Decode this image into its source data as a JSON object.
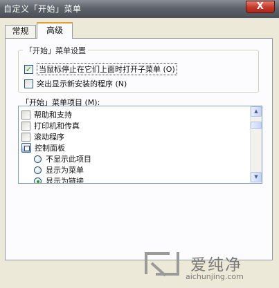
{
  "window": {
    "title": "自定义「开始」菜单",
    "close_glyph": "X"
  },
  "tabs": [
    {
      "label": "常规",
      "active": false
    },
    {
      "label": "高级",
      "active": true
    }
  ],
  "start_menu_settings": {
    "legend": "「开始」菜单设置",
    "options": [
      {
        "label": "当鼠标停止在它们上面时打开子菜单 (O)",
        "checked": true
      },
      {
        "label": "突出显示新安装的程序 (N)",
        "checked": false
      }
    ]
  },
  "items_list": {
    "label": "「开始」菜单项目 (M):",
    "items": [
      {
        "label": "帮助和支持",
        "type": "checkbox",
        "checked": false
      },
      {
        "label": "打印机和传真",
        "type": "checkbox",
        "checked": false
      },
      {
        "label": "滚动程序",
        "type": "checkbox",
        "checked": false
      },
      {
        "label": "控制面板",
        "type": "group",
        "icon": "control-panel-icon"
      },
      {
        "label": "不显示此项目",
        "type": "radio",
        "selected": false
      },
      {
        "label": "显示为菜单",
        "type": "radio",
        "selected": false
      },
      {
        "label": "显示为链接",
        "type": "radio",
        "selected": true
      }
    ]
  },
  "watermark": {
    "brand": "爱纯净",
    "url": "aichunjing.com"
  },
  "colors": {
    "accent_green": "#21a121",
    "tab_highlight": "#e6a02a",
    "titlebar": "#5e636b"
  }
}
